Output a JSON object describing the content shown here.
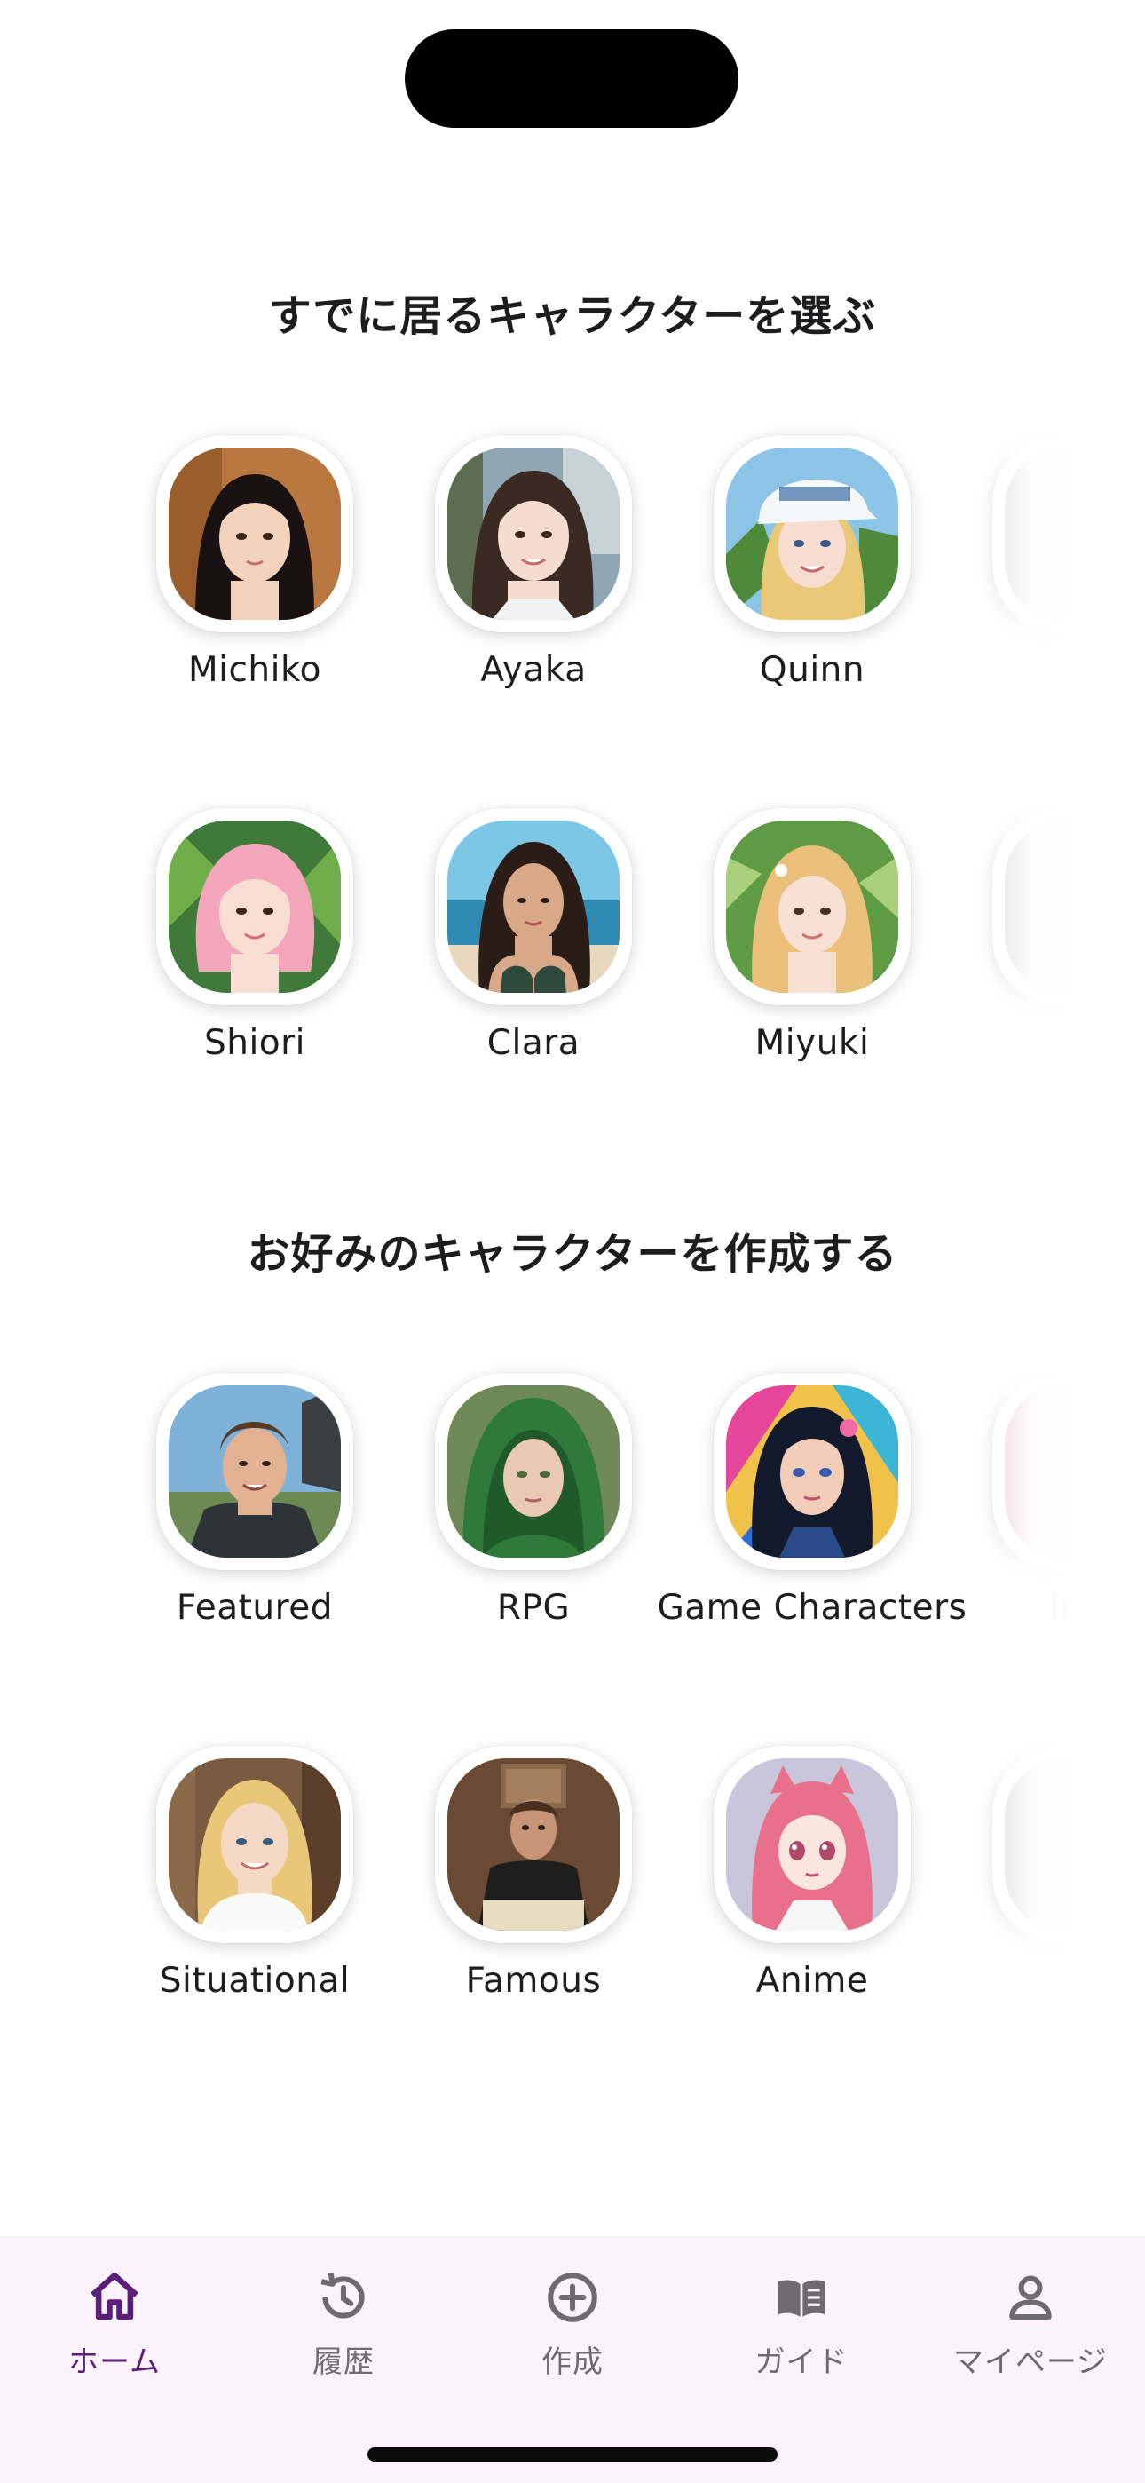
{
  "existing_section": {
    "title": "すでに居るキャラクターを選ぶ",
    "row1": [
      {
        "name": "Michiko"
      },
      {
        "name": "Ayaka"
      },
      {
        "name": "Quinn"
      }
    ],
    "row2": [
      {
        "name": "Shiori"
      },
      {
        "name": "Clara"
      },
      {
        "name": "Miyuki"
      }
    ]
  },
  "create_section": {
    "title": "お好みのキャラクターを作成する",
    "row1": [
      {
        "name": "Featured"
      },
      {
        "name": "RPG"
      },
      {
        "name": "Game Characters"
      },
      {
        "name": "Inter"
      }
    ],
    "row2": [
      {
        "name": "Situational"
      },
      {
        "name": "Famous"
      },
      {
        "name": "Anime"
      }
    ]
  },
  "tabbar": {
    "active_color": "#5b1f7a",
    "inactive_color": "#6f6a72",
    "background": "#fcf2fc",
    "items": [
      {
        "label": "ホーム",
        "icon": "home-icon",
        "active": true
      },
      {
        "label": "履歴",
        "icon": "history-icon",
        "active": false
      },
      {
        "label": "作成",
        "icon": "add-circle-icon",
        "active": false
      },
      {
        "label": "ガイド",
        "icon": "book-icon",
        "active": false
      },
      {
        "label": "マイページ",
        "icon": "person-icon",
        "active": false
      }
    ]
  }
}
